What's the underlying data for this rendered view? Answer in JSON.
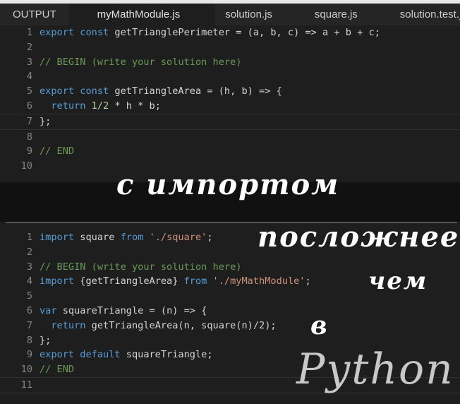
{
  "tabs": [
    {
      "label": "OUTPUT"
    },
    {
      "label": "myMathModule.js"
    },
    {
      "label": "solution.js"
    },
    {
      "label": "square.js"
    },
    {
      "label": "solution.test.js"
    }
  ],
  "top_editor": {
    "lines": [
      [
        [
          "kw",
          "export const "
        ],
        [
          "id",
          "getTrianglePerimeter = (a, b, c) => a + b + c;"
        ]
      ],
      [],
      [
        [
          "cm",
          "// BEGIN (write your solution here)"
        ]
      ],
      [],
      [
        [
          "kw",
          "export const "
        ],
        [
          "id",
          "getTriangleArea = (h, b) => {"
        ]
      ],
      [
        [
          "id",
          "  "
        ],
        [
          "kw",
          "return "
        ],
        [
          "nu",
          "1/2"
        ],
        [
          "id",
          " * h * b;"
        ]
      ],
      [
        [
          "id",
          "};"
        ]
      ],
      [],
      [
        [
          "cm",
          "// END"
        ]
      ],
      []
    ]
  },
  "bottom_editor": {
    "lines": [
      [
        [
          "kw",
          "import "
        ],
        [
          "id",
          "square "
        ],
        [
          "kw",
          "from "
        ],
        [
          "st",
          "'./square'"
        ],
        [
          "id",
          ";"
        ]
      ],
      [],
      [
        [
          "cm",
          "// BEGIN (write your solution here)"
        ]
      ],
      [
        [
          "kw",
          "import "
        ],
        [
          "id",
          "{getTriangleArea} "
        ],
        [
          "kw",
          "from "
        ],
        [
          "st",
          "'./myMathModule'"
        ],
        [
          "id",
          ";"
        ]
      ],
      [],
      [
        [
          "kw",
          "var "
        ],
        [
          "id",
          "squareTriangle = (n) => {"
        ]
      ],
      [
        [
          "id",
          "  "
        ],
        [
          "kw",
          "return "
        ],
        [
          "id",
          "getTriangleArea(n, square(n)/2);"
        ]
      ],
      [
        [
          "id",
          "};"
        ]
      ],
      [
        [
          "kw",
          "export default "
        ],
        [
          "id",
          "squareTriangle;"
        ]
      ],
      [
        [
          "cm",
          "// END"
        ]
      ],
      []
    ]
  },
  "caption": {
    "line1": "с импортом",
    "line2": "посложнее",
    "line3": "чем",
    "line4": "в",
    "line5": "Python"
  }
}
